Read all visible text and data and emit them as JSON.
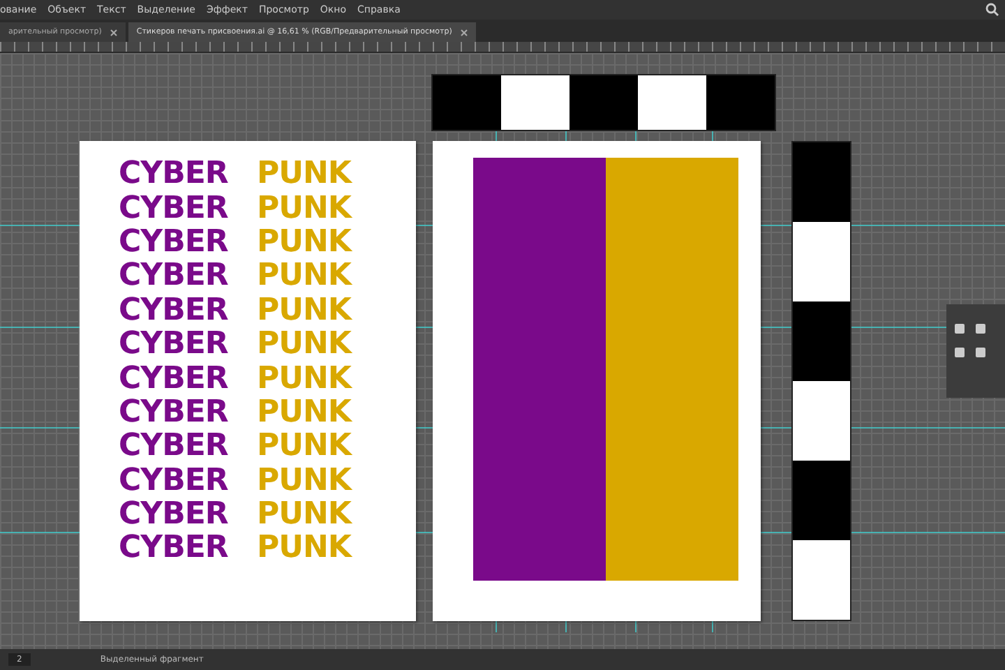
{
  "menu": [
    "ование",
    "Объект",
    "Текст",
    "Выделение",
    "Эффект",
    "Просмотр",
    "Окно",
    "Справка"
  ],
  "tabs": [
    {
      "label": "арительный просмотр)",
      "selected": false
    },
    {
      "label": "Стикеров печать присвоения.ai @ 16,61 % (RGB/Предварительный просмотр)",
      "selected": true
    }
  ],
  "artboard_text": [
    {
      "left": "CYBER",
      "right": "PUNK"
    },
    {
      "left": "CYBER",
      "right": "PUNK"
    },
    {
      "left": "CYBER",
      "right": "PUNK"
    },
    {
      "left": "CYBER",
      "right": "PUNK"
    },
    {
      "left": "CYBER",
      "right": "PUNK"
    },
    {
      "left": "CYBER",
      "right": "PUNK"
    },
    {
      "left": "CYBER",
      "right": "PUNK"
    },
    {
      "left": "CYBER",
      "right": "PUNK"
    },
    {
      "left": "CYBER",
      "right": "PUNK"
    },
    {
      "left": "CYBER",
      "right": "PUNK"
    },
    {
      "left": "CYBER",
      "right": "PUNK"
    },
    {
      "left": "CYBER",
      "right": "PUNK"
    }
  ],
  "stripes": [
    {
      "color": "#7a0a8a"
    },
    {
      "color": "#d9a800"
    }
  ],
  "top_strip": [
    {
      "color": "#000000"
    },
    {
      "color": "#ffffff"
    },
    {
      "color": "#000000"
    },
    {
      "color": "#ffffff"
    },
    {
      "color": "#000000"
    }
  ],
  "side_strip": [
    {
      "color": "#000000"
    },
    {
      "color": "#ffffff"
    },
    {
      "color": "#000000"
    },
    {
      "color": "#ffffff"
    },
    {
      "color": "#000000"
    },
    {
      "color": "#ffffff"
    }
  ],
  "status_bar": {
    "zoom": "2",
    "mode": "Выделенный фрагмент"
  }
}
